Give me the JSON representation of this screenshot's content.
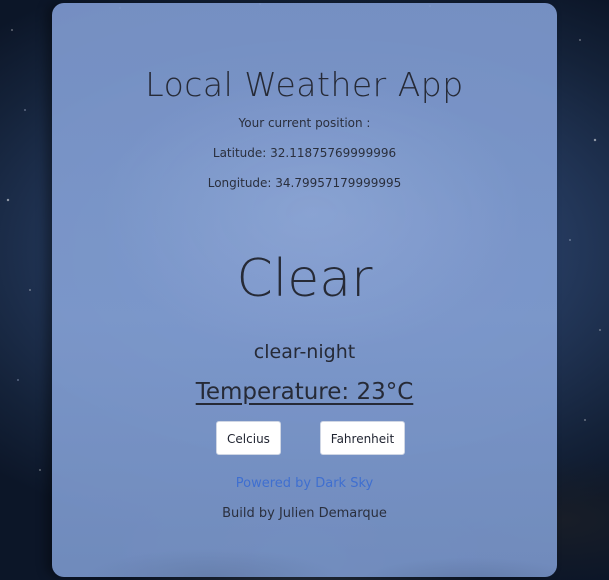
{
  "app": {
    "title": "Local Weather App"
  },
  "position": {
    "label": "Your current position :",
    "latitude_text": "Latitude: 32.11875769999996",
    "longitude_text": "Longitude: 34.79957179999995"
  },
  "weather": {
    "summary": "Clear",
    "icon_name": "clear-night",
    "temperature_text": "Temperature: 23°C"
  },
  "units": {
    "celsius_label": "Celcius",
    "fahrenheit_label": "Fahrenheit"
  },
  "footer": {
    "powered_by": "Powered by Dark Sky",
    "credit": "Build by Julien Demarque"
  },
  "colors": {
    "card": "#7f9bd0",
    "link": "#3f6fd0",
    "text": "#262a36"
  }
}
